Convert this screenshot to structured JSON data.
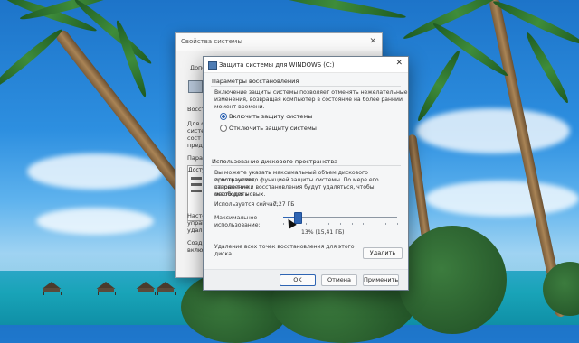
{
  "back_window": {
    "title": "Свойства системы",
    "close_glyph": "✕",
    "tab_label": "Допол",
    "labels": [
      "Восста",
      "Для о",
      "систе",
      "сост",
      "пред",
      "Пара",
      "Доступ"
    ],
    "bottom_labels": [
      "Насте",
      "управ",
      "удал",
      "Созд",
      "включ"
    ]
  },
  "dialog": {
    "title": "Защита системы для WINDOWS (C:)",
    "close_glyph": "✕",
    "restore_settings": {
      "heading": "Параметры восстановления",
      "description": [
        "Включение защиты системы позволяет отменять нежелательные",
        "изменения, возвращая компьютер в состояние на более ранний",
        "момент времени."
      ],
      "options": [
        {
          "label": "Включить защиту системы",
          "selected": true
        },
        {
          "label": "Отключить защиту системы",
          "selected": false
        }
      ]
    },
    "disk_usage": {
      "heading": "Использование дискового пространства",
      "description": [
        "Вы можете указать максимальный объем дискового пространства,",
        "используемого функцией защиты системы. По мере его заполнения",
        "старые точки восстановления будут удаляться, чтобы освободить",
        "место для новых."
      ],
      "current_usage_label": "Используется сейчас:",
      "current_usage_value": "7,27 ГБ",
      "max_usage_label_line1": "Максимальное",
      "max_usage_label_line2": "использование:",
      "max_usage_percent": 13,
      "max_usage_text": "13% (15,41 ГБ)",
      "delete_text_line1": "Удаление всех точек восстановления для этого",
      "delete_text_line2": "диска.",
      "delete_button": "Удалить"
    },
    "buttons": {
      "ok": "OK",
      "cancel": "Отмена",
      "apply": "Применить"
    }
  }
}
